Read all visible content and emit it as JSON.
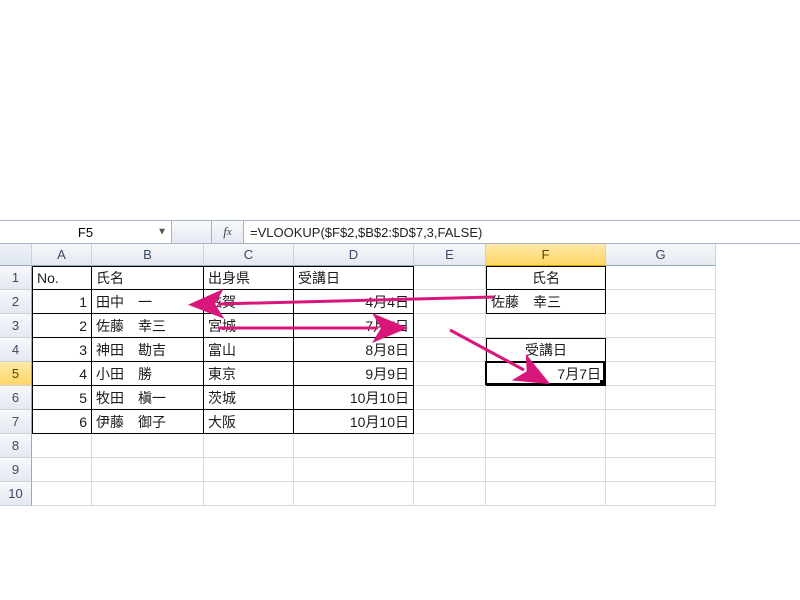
{
  "namebox": {
    "value": "F5"
  },
  "formula": {
    "value": "=VLOOKUP($F$2,$B$2:$D$7,3,FALSE)"
  },
  "columns": [
    "A",
    "B",
    "C",
    "D",
    "E",
    "F",
    "G"
  ],
  "rows": [
    "1",
    "2",
    "3",
    "4",
    "5",
    "6",
    "7",
    "8",
    "9",
    "10"
  ],
  "headers": {
    "no": "No.",
    "name": "氏名",
    "pref": "出身県",
    "date": "受講日"
  },
  "table": [
    {
      "no": "1",
      "name": "田中　一",
      "pref": "滋賀",
      "date": "4月4日"
    },
    {
      "no": "2",
      "name": "佐藤　幸三",
      "pref": "宮城",
      "date": "7月7日"
    },
    {
      "no": "3",
      "name": "神田　勘吉",
      "pref": "富山",
      "date": "8月8日"
    },
    {
      "no": "4",
      "name": "小田　勝",
      "pref": "東京",
      "date": "9月9日"
    },
    {
      "no": "5",
      "name": "牧田　槇一",
      "pref": "茨城",
      "date": "10月10日"
    },
    {
      "no": "6",
      "name": "伊藤　御子",
      "pref": "大阪",
      "date": "10月10日"
    }
  ],
  "lookup": {
    "name_label": "氏名",
    "name_value": "佐藤　幸三",
    "date_label": "受講日",
    "date_value": "7月7日"
  },
  "colors": {
    "arrow": "#d9177a"
  },
  "active_cell": "F5"
}
